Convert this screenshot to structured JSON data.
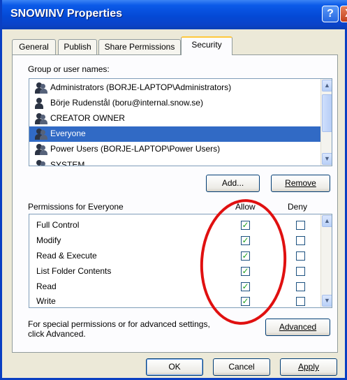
{
  "window": {
    "title": "SNOWINV Properties",
    "help_glyph": "?",
    "close_glyph": "X"
  },
  "tabs": [
    {
      "label": "General",
      "active": false
    },
    {
      "label": "Publish",
      "active": false
    },
    {
      "label": "Share Permissions",
      "active": false
    },
    {
      "label": "Security",
      "active": true
    }
  ],
  "group_section": {
    "label": "Group or user names:",
    "users": [
      {
        "name": "Administrators (BORJE-LAPTOP\\Administrators)",
        "selected": false,
        "icon": "group-icon"
      },
      {
        "name": "Börje Rudenstål (boru@internal.snow.se)",
        "selected": false,
        "icon": "user-icon"
      },
      {
        "name": "CREATOR OWNER",
        "selected": false,
        "icon": "group-icon"
      },
      {
        "name": "Everyone",
        "selected": true,
        "icon": "group-icon"
      },
      {
        "name": "Power Users (BORJE-LAPTOP\\Power Users)",
        "selected": false,
        "icon": "group-icon"
      },
      {
        "name": "SYSTEM",
        "selected": false,
        "icon": "group-icon"
      }
    ],
    "add_label": "Add...",
    "remove_label": "Remove"
  },
  "permissions_section": {
    "label": "Permissions for Everyone",
    "allow_header": "Allow",
    "deny_header": "Deny",
    "rows": [
      {
        "name": "Full Control",
        "allow": true,
        "deny": false
      },
      {
        "name": "Modify",
        "allow": true,
        "deny": false
      },
      {
        "name": "Read & Execute",
        "allow": true,
        "deny": false
      },
      {
        "name": "List Folder Contents",
        "allow": true,
        "deny": false
      },
      {
        "name": "Read",
        "allow": true,
        "deny": false
      },
      {
        "name": "Write",
        "allow": true,
        "deny": false
      }
    ]
  },
  "advanced_section": {
    "text_line1": "For special permissions or for advanced settings,",
    "text_line2": "click Advanced.",
    "button_label": "Advanced"
  },
  "footer": {
    "ok_label": "OK",
    "cancel_label": "Cancel",
    "apply_label": "Apply"
  },
  "colors": {
    "titlebar": "#0449d6",
    "selection": "#316ac5",
    "annotation": "#e01010",
    "checkmark": "#21a121"
  }
}
